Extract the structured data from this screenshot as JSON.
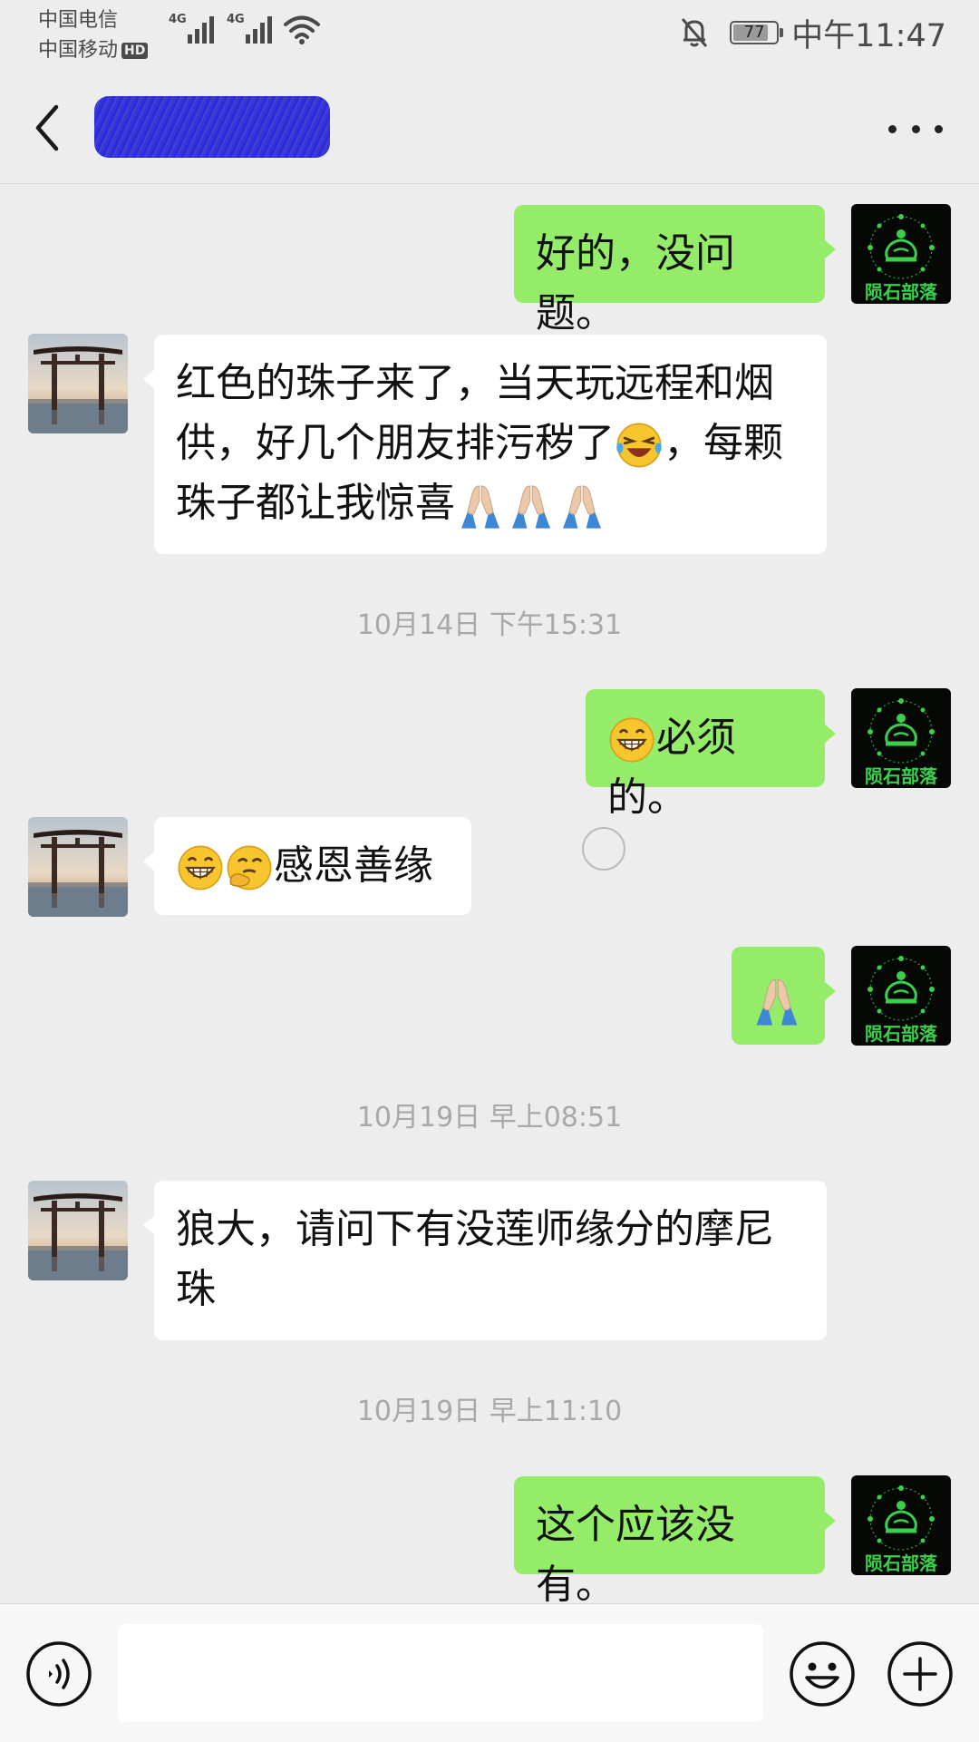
{
  "status": {
    "carrier1": "中国电信",
    "carrier2": "中国移动",
    "hd": "HD",
    "net1": "4G",
    "net2": "4G",
    "battery": "77",
    "time": "中午11:47"
  },
  "header": {
    "contact_name": "",
    "back_icon": "chevron-left-icon",
    "more_icon": "more-dots-icon"
  },
  "avatars": {
    "self_text": "陨石部落",
    "other": "torii-gate-photo"
  },
  "messages": [
    {
      "side": "out",
      "text": "好的，没问题。"
    },
    {
      "side": "in",
      "line1": "红色的珠子来了，当天玩远程和烟",
      "line2a": "供，好几个朋友排污秽了",
      "line2b": "，每颗",
      "line3": "珠子都让我惊喜"
    },
    {
      "side": "out",
      "text": "必须的。"
    },
    {
      "side": "in",
      "text": "感恩善缘"
    },
    {
      "side": "out",
      "text": ""
    },
    {
      "side": "in",
      "line1": "狼大，请问下有没莲师缘分的摩尼",
      "line2": "珠"
    },
    {
      "side": "out",
      "text": "这个应该没有。"
    }
  ],
  "timestamps": [
    "10月14日 下午15:31",
    "10月19日 早上08:51",
    "10月19日 早上11:10"
  ],
  "input": {
    "value": "",
    "voice_icon": "voice-icon",
    "emoji_icon": "smiley-icon",
    "plus_icon": "plus-icon"
  },
  "colors": {
    "background": "#ededed",
    "outgoing_bubble": "#95ec69",
    "incoming_bubble": "#ffffff",
    "avatar_green": "#39c24a"
  }
}
